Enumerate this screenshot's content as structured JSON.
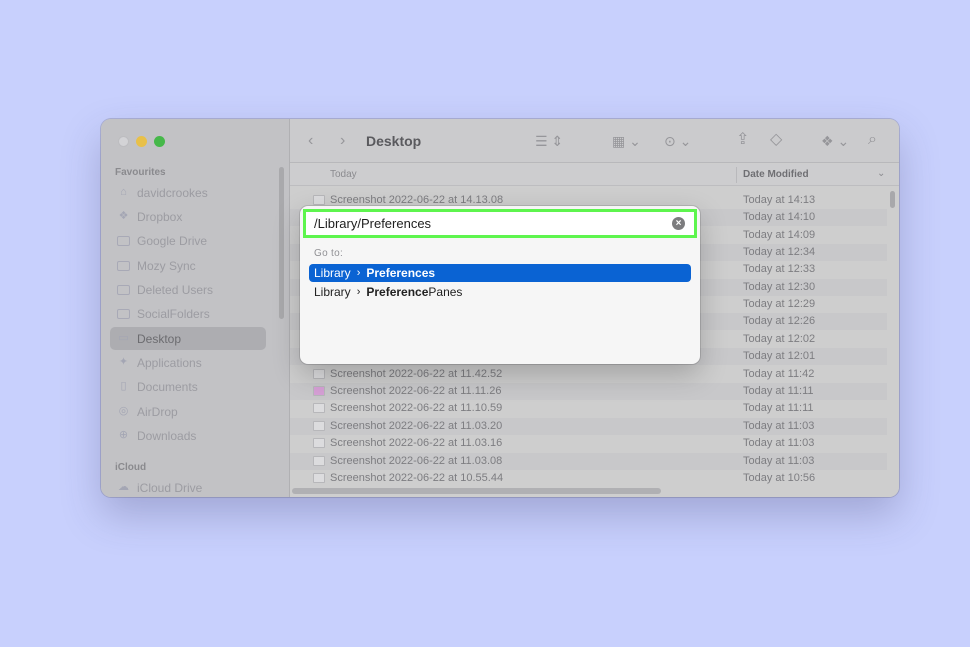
{
  "finder": {
    "title": "Desktop",
    "sidebar": {
      "sections": [
        {
          "label": "Favourites"
        },
        {
          "label": "iCloud"
        }
      ],
      "items": [
        {
          "label": "davidcrookes",
          "icon": "home-icon"
        },
        {
          "label": "Dropbox",
          "icon": "dropbox-icon"
        },
        {
          "label": "Google Drive",
          "icon": "folder-icon"
        },
        {
          "label": "Mozy Sync",
          "icon": "folder-icon"
        },
        {
          "label": "Deleted Users",
          "icon": "folder-icon"
        },
        {
          "label": "SocialFolders",
          "icon": "folder-icon"
        },
        {
          "label": "Desktop",
          "icon": "desktop-icon",
          "active": true
        },
        {
          "label": "Applications",
          "icon": "applications-icon"
        },
        {
          "label": "Documents",
          "icon": "document-icon"
        },
        {
          "label": "AirDrop",
          "icon": "airdrop-icon"
        },
        {
          "label": "Downloads",
          "icon": "downloads-icon"
        },
        {
          "label": "iCloud Drive",
          "icon": "cloud-icon"
        }
      ]
    },
    "columns": {
      "group": "Today",
      "date": "Date Modified"
    },
    "files": [
      {
        "name": "Screenshot 2022-06-22 at 14.13.08",
        "date": "Today at 14:13"
      },
      {
        "name": "",
        "date": "Today at 14:10"
      },
      {
        "name": "",
        "date": "Today at 14:09"
      },
      {
        "name": "",
        "date": "Today at 12:34"
      },
      {
        "name": "",
        "date": "Today at 12:33"
      },
      {
        "name": "",
        "date": "Today at 12:30"
      },
      {
        "name": "",
        "date": "Today at 12:29"
      },
      {
        "name": "",
        "date": "Today at 12:26"
      },
      {
        "name": "",
        "date": "Today at 12:02"
      },
      {
        "name": "",
        "date": "Today at 12:01"
      },
      {
        "name": "Screenshot 2022-06-22 at 11.42.52",
        "date": "Today at 11:42"
      },
      {
        "name": "Screenshot 2022-06-22 at 11.11.26",
        "date": "Today at 11:11"
      },
      {
        "name": "Screenshot 2022-06-22 at 11.10.59",
        "date": "Today at 11:11"
      },
      {
        "name": "Screenshot 2022-06-22 at 11.03.20",
        "date": "Today at 11:03"
      },
      {
        "name": "Screenshot 2022-06-22 at 11.03.16",
        "date": "Today at 11:03"
      },
      {
        "name": "Screenshot 2022-06-22 at 11.03.08",
        "date": "Today at 11:03"
      },
      {
        "name": "Screenshot 2022-06-22 at 10.55.44",
        "date": "Today at 10:56"
      }
    ]
  },
  "goto": {
    "value": "/Library/Preferences",
    "label": "Go to:",
    "suggestions": [
      {
        "parent": "Library",
        "match": "Preferences",
        "rest": ""
      },
      {
        "parent": "Library",
        "match": "Preference",
        "rest": "Panes"
      }
    ]
  },
  "colors": {
    "background": "#c8d0fd",
    "highlight": "#0a63d3",
    "focus_ring": "#5ef54e"
  }
}
